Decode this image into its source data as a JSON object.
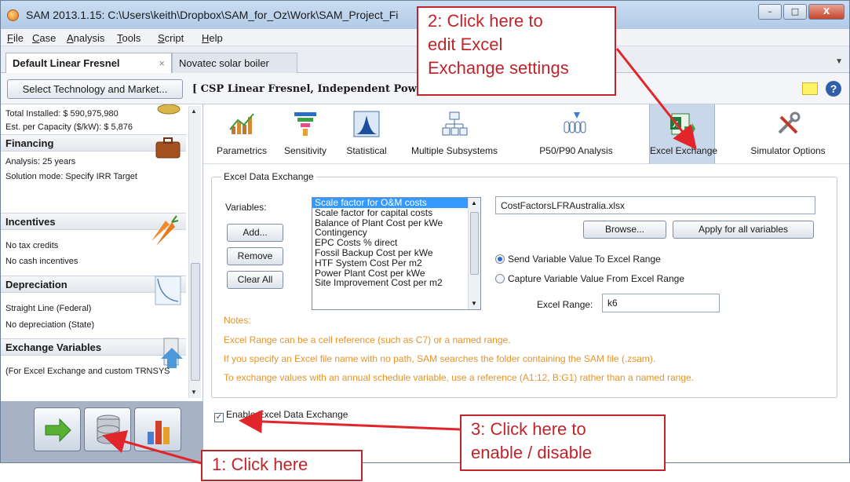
{
  "window": {
    "title": "SAM 2013.1.15: C:\\Users\\keith\\Dropbox\\SAM_for_Oz\\Work\\SAM_Project_Fi",
    "controls": {
      "minimize": "–",
      "maximize": "□",
      "close": "X"
    }
  },
  "menu": {
    "items": [
      {
        "mnemonic": "F",
        "rest": "ile"
      },
      {
        "mnemonic": "C",
        "rest": "ase"
      },
      {
        "mnemonic": "A",
        "rest": "nalysis"
      },
      {
        "mnemonic": "T",
        "rest": "ools"
      },
      {
        "mnemonic": "S",
        "rest": "cript"
      },
      {
        "mnemonic": "H",
        "rest": "elp"
      }
    ]
  },
  "case_tabs": [
    {
      "label": "Default Linear Fresnel",
      "close": "×",
      "active": true
    },
    {
      "label": "Novatec solar boiler",
      "active": false
    }
  ],
  "techbar": {
    "select_button": "Select Technology and Market...",
    "config_label": "[ CSP Linear Fresnel, Independent Power P"
  },
  "sidebar": {
    "total_installed": "Total Installed: $ 590,975,980",
    "per_capacity": "Est. per Capacity ($/kW): $ 5,876",
    "sections": [
      {
        "title": "Financing",
        "lines": [
          "Analysis: 25 years",
          "Solution mode: Specify IRR Target"
        ]
      },
      {
        "title": "Incentives",
        "lines": [
          "No tax credits",
          "No cash incentives"
        ]
      },
      {
        "title": "Depreciation",
        "lines": [
          "Straight Line (Federal)",
          "No depreciation (State)"
        ]
      },
      {
        "title": "Exchange Variables",
        "lines": [
          "(For Excel Exchange and custom TRNSYS"
        ]
      }
    ]
  },
  "toolbar": {
    "tools": [
      {
        "label": "Parametrics",
        "icon": "parametrics-icon"
      },
      {
        "label": "Sensitivity",
        "icon": "sensitivity-icon"
      },
      {
        "label": "Statistical",
        "icon": "statistical-icon"
      },
      {
        "label": "Multiple Subsystems",
        "icon": "multiple-subsystems-icon"
      },
      {
        "label": "P50/P90 Analysis",
        "icon": "p50-p90-icon"
      },
      {
        "label": "Excel Exchange",
        "icon": "excel-exchange-icon",
        "active": true
      },
      {
        "label": "Simulator Options",
        "icon": "simulator-options-icon"
      }
    ]
  },
  "excel_exchange": {
    "group_title": "Excel Data Exchange",
    "variables_label": "Variables:",
    "buttons": {
      "add": "Add...",
      "remove": "Remove",
      "clear_all": "Clear All",
      "browse": "Browse...",
      "apply_all": "Apply for all variables"
    },
    "variables": [
      "Scale factor for O&M costs",
      "Scale factor for capital costs",
      "Balance of Plant Cost per kWe",
      "Contingency",
      "EPC Costs % direct",
      "Fossil Backup Cost per kWe",
      "HTF System Cost Per m2",
      "Power Plant Cost per kWe",
      "Site Improvement Cost per m2"
    ],
    "selected_variable": "Scale factor for O&M costs",
    "file_name": "CostFactorsLFRAustralia.xlsx",
    "radio_send": "Send Variable Value To Excel Range",
    "radio_capture": "Capture Variable Value From Excel Range",
    "radio_selected": "send",
    "range_label": "Excel Range:",
    "range_value": "k6",
    "notes_title": "Notes:",
    "notes": [
      "Excel Range can be a cell reference (such as C7) or a named range.",
      "If you specify an Excel file name with no path, SAM searches the folder containing the SAM file (.zsam).",
      "To exchange values with an annual schedule variable, use a reference (A1:12, B:G1) rather than a named range."
    ],
    "enable_label": "Enable Excel Data Exchange",
    "enable_checked": true
  },
  "callouts": {
    "c1": "1: Click here",
    "c2_lines": [
      "2: Click here to",
      "edit Excel",
      "Exchange settings"
    ],
    "c3_lines": [
      "3: Click here to",
      "enable / disable"
    ]
  },
  "colors": {
    "callout": "#c0252b",
    "notes": "#e6942a",
    "selection": "#3399ff"
  }
}
